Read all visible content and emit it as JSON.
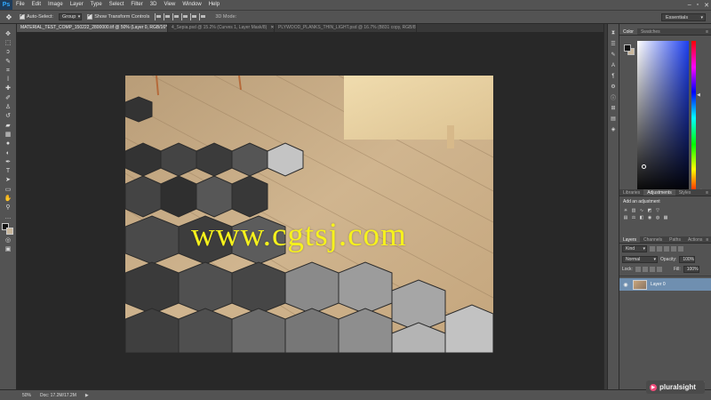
{
  "app": {
    "logo": "Ps",
    "menu": [
      "File",
      "Edit",
      "Image",
      "Layer",
      "Type",
      "Select",
      "Filter",
      "3D",
      "View",
      "Window",
      "Help"
    ],
    "window_controls": [
      "–",
      "▫",
      "✕"
    ]
  },
  "options_bar": {
    "auto_select_label": "Auto-Select:",
    "auto_select_target": "Group",
    "show_transform_label": "Show Transform Controls",
    "mode_3d_label": "3D Mode:",
    "workspace": "Essentials"
  },
  "tabs": [
    {
      "label": "MATERIAL_TEST_COMP_150222_2800000.tif @ 50% (Layer 0, RGB/16*)",
      "active": true
    },
    {
      "label": "4_Sepia.psd @ 15.2% (Curves 1, Layer Mask/8)",
      "active": false
    },
    {
      "label": "PLYWOOD_PLANKS_THIN_LIGHT.psd @ 16.7% (B831 copy, RGB/8)",
      "active": false
    }
  ],
  "watermark": "www.cgtsj.com",
  "panels": {
    "color_tabs": [
      "Color",
      "Swatches"
    ],
    "adjust_tabs": [
      "Libraries",
      "Adjustments",
      "Styles"
    ],
    "adjust_title": "Add an adjustment",
    "layers_tabs": [
      "Layers",
      "Channels",
      "Paths",
      "Actions"
    ],
    "kind_filter": "Kind",
    "blend_mode": "Normal",
    "opacity_label": "Opacity:",
    "opacity_value": "100%",
    "lock_label": "Lock:",
    "fill_label": "Fill:",
    "fill_value": "100%",
    "layer_name": "Layer 0"
  },
  "status": {
    "zoom": "50%",
    "doc": "Doc: 17.2M/17.2M"
  },
  "branding": "pluralsight",
  "colors": {
    "foreground": "#121212",
    "background": "#c9b79c",
    "accent": "#31a8ff"
  }
}
